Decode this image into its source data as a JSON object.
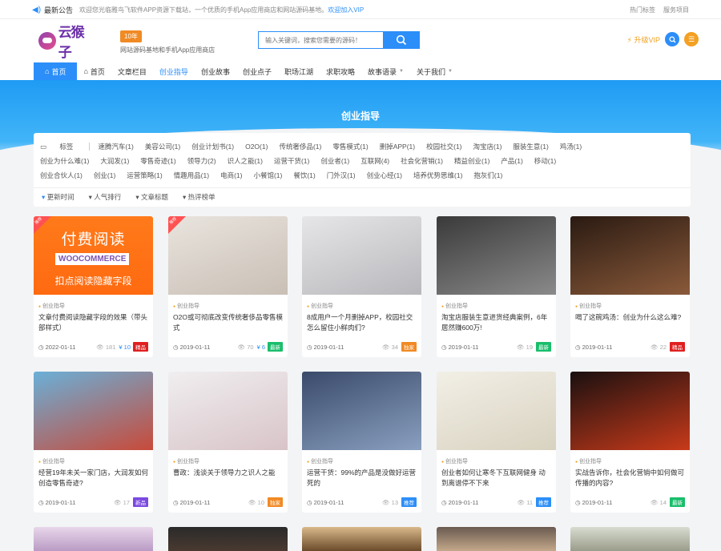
{
  "notice": {
    "label": "最新公告",
    "message": "欢迎您光临雅鸟飞软件APP资源下载站，一个优质的手机App应用商店和网站源码基地。",
    "vip_link": "欢迎加入VIP",
    "links": [
      "热门标签",
      "服务项目"
    ]
  },
  "header": {
    "logo_text": "云猴子",
    "year_badge": "10年",
    "tagline": "网站源码基地和手机App应用商店",
    "search_placeholder": "输入关键词，搜索您需要的源码！",
    "vip_label": "升级VIP"
  },
  "nav": [
    {
      "label": "首页",
      "active": false,
      "home": true
    },
    {
      "label": "首页"
    },
    {
      "label": "文章栏目"
    },
    {
      "label": "创业指导",
      "active": true
    },
    {
      "label": "创业故事"
    },
    {
      "label": "创业点子"
    },
    {
      "label": "职场江湖"
    },
    {
      "label": "求职攻略"
    },
    {
      "label": "故事语录",
      "caret": true
    },
    {
      "label": "关于我们",
      "caret": true
    }
  ],
  "banner": {
    "title": "创业指导"
  },
  "tags": {
    "label": "标签",
    "row1": [
      "速腾汽车(1)",
      "美容公司(1)",
      "创业计划书(1)",
      "O2O(1)",
      "传统奢侈品(1)",
      "零售模式(1)",
      "删掉APP(1)",
      "校园社交(1)",
      "淘宝店(1)",
      "服装生意(1)",
      "鸡汤(1)"
    ],
    "row2": [
      "创业为什么难(1)",
      "大润发(1)",
      "零售奇迹(1)",
      "领导力(2)",
      "识人之能(1)",
      "运营干货(1)",
      "创业者(1)",
      "互联网(4)",
      "社会化营销(1)",
      "精益创业(1)",
      "产品(1)",
      "移动(1)"
    ],
    "row3": [
      "创业合伙人(1)",
      "创业(1)",
      "运营策略(1)",
      "情趣用品(1)",
      "电商(1)",
      "小餐馆(1)",
      "餐饮(1)",
      "门外汉(1)",
      "创业心经(1)",
      "培养优势思维(1)",
      "抱灰们(1)"
    ]
  },
  "sort": [
    "更新时间",
    "人气排行",
    "文章标题",
    "热评榜单"
  ],
  "cards": [
    {
      "category": "创业指导",
      "title": "文章付费阅读隐藏字段的效果（带头部样式）",
      "date": "2022-01-11",
      "views": "181",
      "price": "¥ 10",
      "badge": "精品",
      "badge_color": "#e02020",
      "corner": "推荐",
      "thumb_lines": [
        "付费阅读",
        "WOOCOMMERCE",
        "扣点阅读隐藏字段"
      ]
    },
    {
      "category": "创业指导",
      "title": "O2O或可彻底改变传统奢侈品零售模式",
      "date": "2019-01-11",
      "views": "70",
      "price": "¥ 6",
      "badge": "最新",
      "badge_color": "#19be6b",
      "corner": "推荐"
    },
    {
      "category": "创业指导",
      "title": "8成用户一个月删掉APP，校园社交怎么留住小鲜肉们?",
      "date": "2019-01-11",
      "views": "34",
      "price": "",
      "badge": "独家",
      "badge_color": "#f08a24"
    },
    {
      "category": "创业指导",
      "title": "淘宝店服装生意进货经典案例，6年居然赚600万!",
      "date": "2019-01-11",
      "views": "19",
      "price": "",
      "badge": "最新",
      "badge_color": "#19be6b"
    },
    {
      "category": "创业指导",
      "title": "喝了这碗鸡汤：创业为什么这么难?",
      "date": "2019-01-11",
      "views": "22",
      "price": "",
      "badge": "精品",
      "badge_color": "#e02020"
    },
    {
      "category": "创业指导",
      "title": "经营19年未关一家门店，大润发如何创造零售奇迹?",
      "date": "2019-01-11",
      "views": "17",
      "price": "",
      "badge": "新品",
      "badge_color": "#7b4ae0"
    },
    {
      "category": "创业指导",
      "title": "曹政：浅谈关于领导力之识人之能",
      "date": "2019-01-11",
      "views": "10",
      "price": "",
      "badge": "独家",
      "badge_color": "#f08a24"
    },
    {
      "category": "创业指导",
      "title": "运营干货：99%的产品是没做好运营死的",
      "date": "2019-01-11",
      "views": "13",
      "price": "",
      "badge": "推荐",
      "badge_color": "#2c8ef8"
    },
    {
      "category": "创业指导",
      "title": "创业者如何让寒冬下互联网健身 动到离谱停不下来",
      "date": "2019-01-11",
      "views": "11",
      "price": "",
      "badge": "推荐",
      "badge_color": "#2c8ef8"
    },
    {
      "category": "创业指导",
      "title": "实战告诉你，社会化营销中如何做可传播的内容?",
      "date": "2019-01-11",
      "views": "14",
      "price": "",
      "badge": "最新",
      "badge_color": "#19be6b"
    }
  ]
}
